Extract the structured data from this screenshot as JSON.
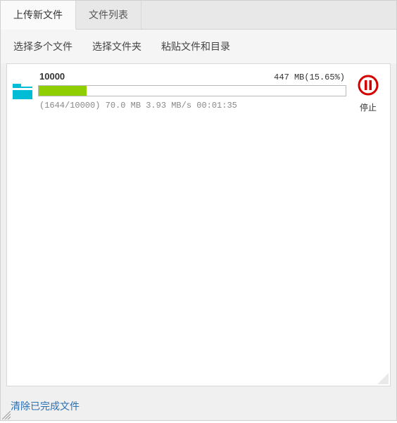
{
  "tabs": [
    {
      "label": "上传新文件",
      "active": true
    },
    {
      "label": "文件列表",
      "active": false
    }
  ],
  "toolbar": {
    "select_multiple": "选择多个文件",
    "select_folder": "选择文件夹",
    "paste_path": "粘贴文件和目录"
  },
  "upload": {
    "name": "10000",
    "size_text": "447 MB(15.65%)",
    "progress_percent": 15.65,
    "stats": "(1644/10000) 70.0 MB 3.93 MB/s 00:01:35",
    "stop_label": "停止"
  },
  "footer": {
    "clear_completed": "清除已完成文件"
  }
}
